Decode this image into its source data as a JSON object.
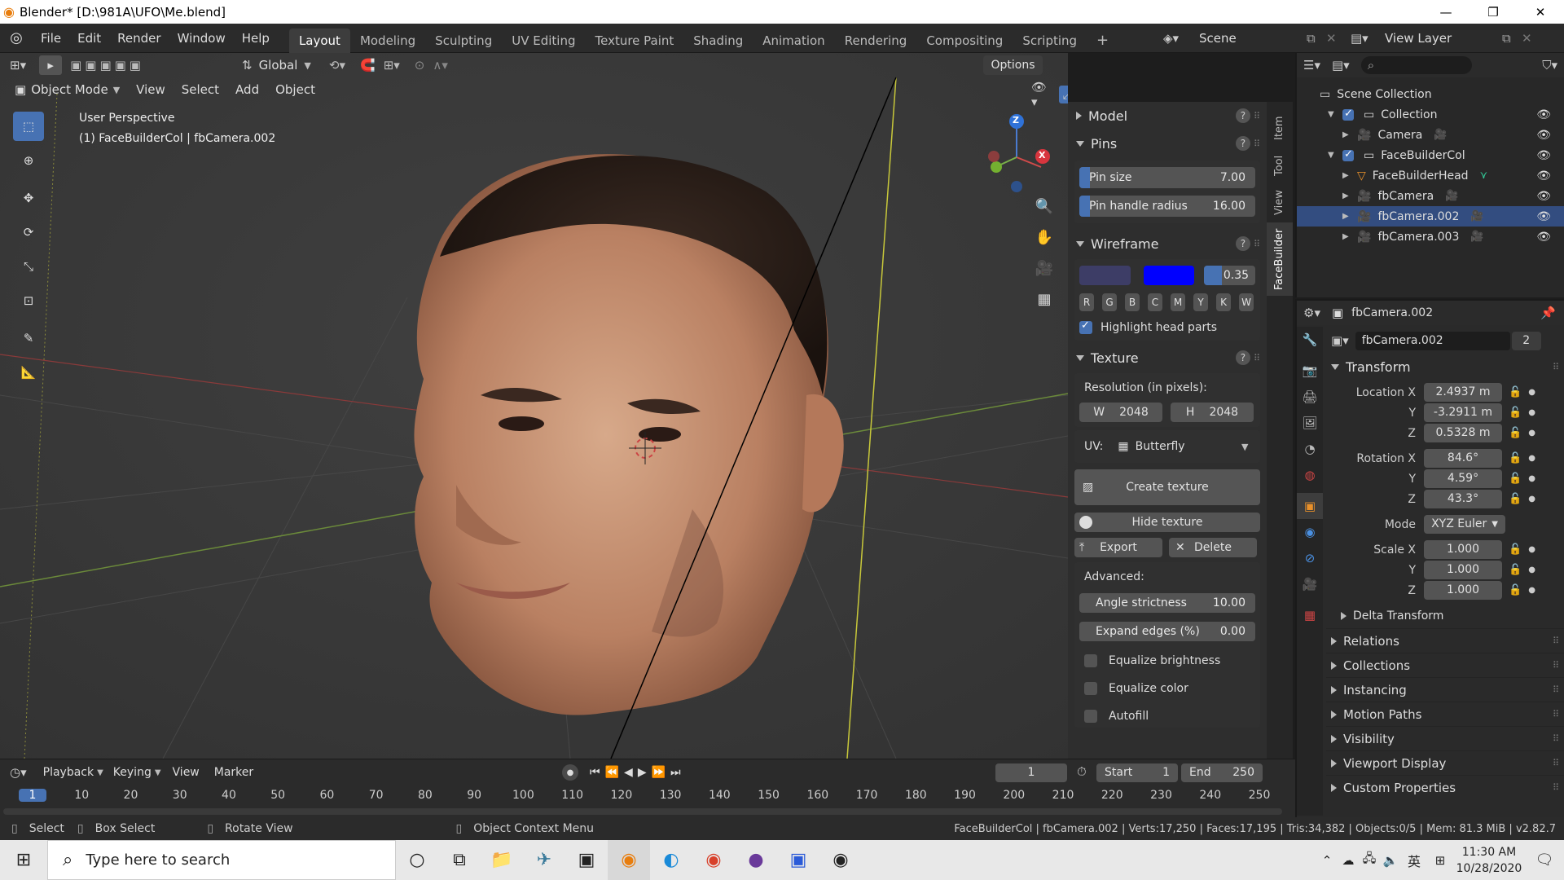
{
  "window": {
    "title": "Blender* [D:\\981A\\UFO\\Me.blend]",
    "controls": [
      "—",
      "❐",
      "✕"
    ]
  },
  "menu": {
    "items": [
      "File",
      "Edit",
      "Render",
      "Window",
      "Help"
    ]
  },
  "workspaces": [
    "Layout",
    "Modeling",
    "Sculpting",
    "UV Editing",
    "Texture Paint",
    "Shading",
    "Animation",
    "Rendering",
    "Compositing",
    "Scripting"
  ],
  "workspace_add": "+",
  "scene": {
    "name": "Scene",
    "view_layer": "View Layer"
  },
  "viewport": {
    "transform_orientation": "Global",
    "options_label": "Options",
    "mode": "Object Mode",
    "header_menus": [
      "View",
      "Select",
      "Add",
      "Object"
    ],
    "perspective": "User Perspective",
    "active_info": "(1) FaceBuilderCol | fbCamera.002"
  },
  "gizmo": {
    "z": "Z",
    "x": "X"
  },
  "n_panel": {
    "tabs": [
      "Item",
      "Tool",
      "View",
      "FaceBuilder"
    ],
    "model_label": "Model",
    "pins_label": "Pins",
    "pin_size": {
      "label": "Pin size",
      "value": "7.00",
      "fill": 0.06
    },
    "pin_handle_radius": {
      "label": "Pin handle radius",
      "value": "16.00",
      "fill": 0.06
    },
    "wireframe_label": "Wireframe",
    "wire_colors": {
      "color1": "#3d3d66",
      "color2": "#0000ff"
    },
    "wire_opacity": {
      "value": "0.35",
      "fill": 0.35
    },
    "wire_buttons": [
      "R",
      "G",
      "B",
      "C",
      "M",
      "Y",
      "K",
      "W"
    ],
    "highlight_head_parts": "Highlight head parts",
    "texture_label": "Texture",
    "resolution_label": "Resolution (in pixels):",
    "res_w_label": "W",
    "res_w_value": "2048",
    "res_h_label": "H",
    "res_h_value": "2048",
    "uv_label": "UV:",
    "uv_value": "Butterfly",
    "create_texture": "Create texture",
    "hide_texture": "Hide texture",
    "export": "Export",
    "delete": "Delete",
    "advanced_label": "Advanced:",
    "angle_strictness": {
      "label": "Angle strictness",
      "value": "10.00"
    },
    "expand_edges": {
      "label": "Expand edges (%)",
      "value": "0.00"
    },
    "equalize_brightness": "Equalize brightness",
    "equalize_color": "Equalize color",
    "autofill": "Autofill"
  },
  "outliner": {
    "search_placeholder": "",
    "root": "Scene Collection",
    "items": [
      {
        "label": "Collection",
        "indent": 1,
        "type": "collection"
      },
      {
        "label": "Camera",
        "indent": 2,
        "type": "camera"
      },
      {
        "label": "FaceBuilderCol",
        "indent": 1,
        "type": "collection"
      },
      {
        "label": "FaceBuilderHead",
        "indent": 2,
        "type": "mesh"
      },
      {
        "label": "fbCamera",
        "indent": 2,
        "type": "camera"
      },
      {
        "label": "fbCamera.002",
        "indent": 2,
        "type": "camera"
      },
      {
        "label": "fbCamera.003",
        "indent": 2,
        "type": "camera"
      }
    ]
  },
  "properties": {
    "object_name": "fbCamera.002",
    "data_name": "fbCamera.002",
    "users": "2",
    "transform_label": "Transform",
    "location_label": "Location X",
    "location": {
      "x": "2.4937 m",
      "y": "-3.2911 m",
      "z": "0.5328 m"
    },
    "rotation_label": "Rotation X",
    "rotation": {
      "x": "84.6°",
      "y": "4.59°",
      "z": "43.3°"
    },
    "mode_label": "Mode",
    "mode_value": "XYZ Euler",
    "scale_label": "Scale X",
    "scale": {
      "x": "1.000",
      "y": "1.000",
      "z": "1.000"
    },
    "y_label": "Y",
    "z_label": "Z",
    "delta_transform": "Delta Transform",
    "sections": [
      "Relations",
      "Collections",
      "Instancing",
      "Motion Paths",
      "Visibility",
      "Viewport Display",
      "Custom Properties"
    ]
  },
  "timeline": {
    "menus": [
      "Playback",
      "Keying",
      "View",
      "Marker"
    ],
    "current_frame": "1",
    "start_label": "Start",
    "start_value": "1",
    "end_label": "End",
    "end_value": "250",
    "ruler": [
      "1",
      "10",
      "20",
      "30",
      "40",
      "50",
      "60",
      "70",
      "80",
      "90",
      "100",
      "110",
      "120",
      "130",
      "140",
      "150",
      "160",
      "170",
      "180",
      "190",
      "200",
      "210",
      "220",
      "230",
      "240",
      "250"
    ]
  },
  "statusbar": {
    "select": "Select",
    "box_select": "Box Select",
    "rotate_view": "Rotate View",
    "context_menu": "Object Context Menu",
    "stats": "FaceBuilderCol | fbCamera.002 | Verts:17,250 | Faces:17,195 | Tris:34,382 | Objects:0/5 | Mem: 81.3 MiB | v2.82.7"
  },
  "taskbar": {
    "search_placeholder": "Type here to search",
    "time": "11:30 AM",
    "date": "10/28/2020",
    "ime": "英"
  }
}
